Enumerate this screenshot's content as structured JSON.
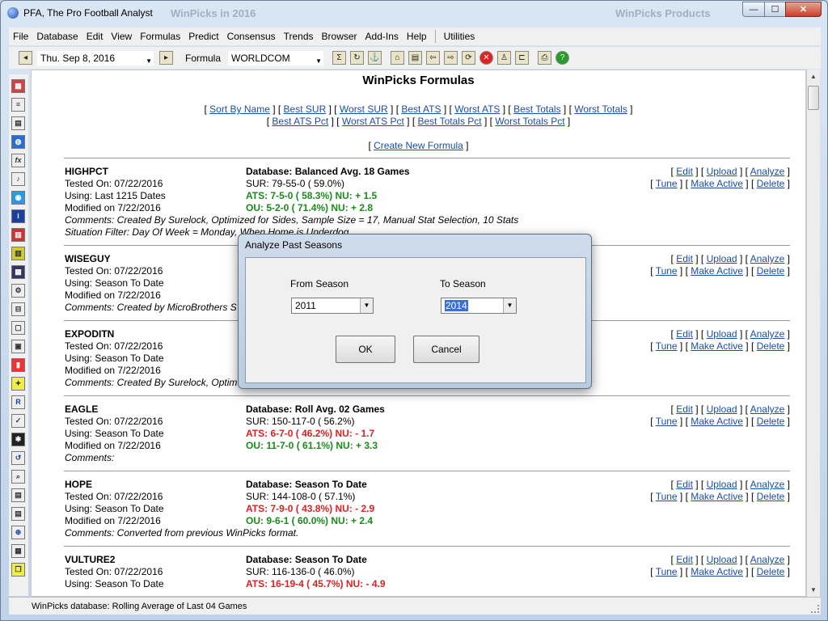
{
  "window": {
    "title": "PFA,  The Pro Football Analyst",
    "ghost_center": "WinPicks in 2016",
    "ghost_right": "WinPicks Products",
    "min_glyph": "—",
    "max_glyph": "☐",
    "close_glyph": "✕"
  },
  "menu": [
    "File",
    "Database",
    "Edit",
    "View",
    "Formulas",
    "Predict",
    "Consensus",
    "Trends",
    "Browser",
    "Add-Ins",
    "Help"
  ],
  "menu_utilities": "Utilities",
  "toolbar": {
    "date": "Thu. Sep  8, 2016",
    "formula_label": "Formula",
    "formula_value": "WORLDCOM"
  },
  "page": {
    "title": "WinPicks Formulas",
    "sort_links_row1": [
      "Sort By Name",
      "Best SUR",
      "Worst SUR",
      "Best ATS",
      "Worst ATS",
      "Best Totals",
      "Worst Totals"
    ],
    "sort_links_row2": [
      "Best ATS Pct",
      "Worst ATS Pct",
      "Best Totals Pct",
      "Worst Totals Pct"
    ],
    "create_link": "Create New Formula",
    "action_row1": [
      "Edit",
      "Upload",
      "Analyze"
    ],
    "action_row2": [
      "Tune",
      "Make Active",
      "Delete"
    ]
  },
  "formulas": [
    {
      "name": "HIGHPCT",
      "tested": "Tested On: 07/22/2016",
      "using": "Using: Last 1215 Dates",
      "modified": "Modified on 7/22/2016",
      "comments": "Comments: Created By Surelock, Optimized for Sides, Sample Size = 17, Manual Stat Selection, 10 Stats",
      "extra": "Situation Filter: Day Of Week = Monday, When Home is Underdog",
      "database": "Database: Balanced Avg. 18 Games",
      "sur": "SUR: 79-55-0 ( 59.0%)",
      "ats": "ATS: 7-5-0 ( 58.3%) NU: + 1.5",
      "ats_color": "green",
      "ou": "OU: 5-2-0 ( 71.4%) NU: + 2.8",
      "ou_color": "green"
    },
    {
      "name": "WISEGUY",
      "tested": "Tested On: 07/22/2016",
      "using": "Using: Season To Date",
      "modified": "Modified on 7/22/2016",
      "comments": "Comments: Created by MicroBrothers S",
      "extra": "",
      "database": "",
      "sur": "",
      "ats": "",
      "ats_color": "green",
      "ou": "",
      "ou_color": "green"
    },
    {
      "name": "EXPODITN",
      "tested": "Tested On: 07/22/2016",
      "using": "Using: Season To Date",
      "modified": "Modified on 7/22/2016",
      "comments": "Comments: Created By Surelock, Optim",
      "extra": "",
      "database": "",
      "sur": "",
      "ats": "",
      "ats_color": "green",
      "ou": "",
      "ou_color": "green"
    },
    {
      "name": "EAGLE",
      "tested": "Tested On: 07/22/2016",
      "using": "Using: Season To Date",
      "modified": "Modified on 7/22/2016",
      "comments": "Comments:",
      "extra": "",
      "database": "Database: Roll Avg. 02 Games",
      "sur": "SUR: 150-117-0 ( 56.2%)",
      "ats": "ATS: 6-7-0 ( 46.2%) NU: - 1.7",
      "ats_color": "red",
      "ou": "OU: 11-7-0 ( 61.1%) NU: + 3.3",
      "ou_color": "green"
    },
    {
      "name": "HOPE",
      "tested": "Tested On: 07/22/2016",
      "using": "Using: Season To Date",
      "modified": "Modified on 7/22/2016",
      "comments": "Comments: Converted from previous WinPicks format.",
      "extra": "",
      "database": "Database: Season To Date",
      "sur": "SUR: 144-108-0 ( 57.1%)",
      "ats": "ATS: 7-9-0 ( 43.8%) NU: - 2.9",
      "ats_color": "red",
      "ou": "OU: 9-6-1 ( 60.0%) NU: + 2.4",
      "ou_color": "green"
    },
    {
      "name": "VULTURE2",
      "tested": "Tested On: 07/22/2016",
      "using": "Using: Season To Date",
      "modified": "",
      "comments": "",
      "extra": "",
      "database": "Database: Season To Date",
      "sur": "SUR: 116-136-0 ( 46.0%)",
      "ats": "ATS: 16-19-4 ( 45.7%) NU: - 4.9",
      "ats_color": "red",
      "ou": "",
      "ou_color": "green"
    }
  ],
  "statusbar": "WinPicks database:  Rolling Average of Last 04 Games",
  "dialog": {
    "title": "Analyze Past Seasons",
    "from_label": "From Season",
    "from_value": "2011",
    "to_label": "To Season",
    "to_value": "2014",
    "ok": "OK",
    "cancel": "Cancel"
  },
  "colors": {
    "link": "#1a4ea8",
    "positive": "#1a8a1a",
    "negative": "#e02020"
  }
}
